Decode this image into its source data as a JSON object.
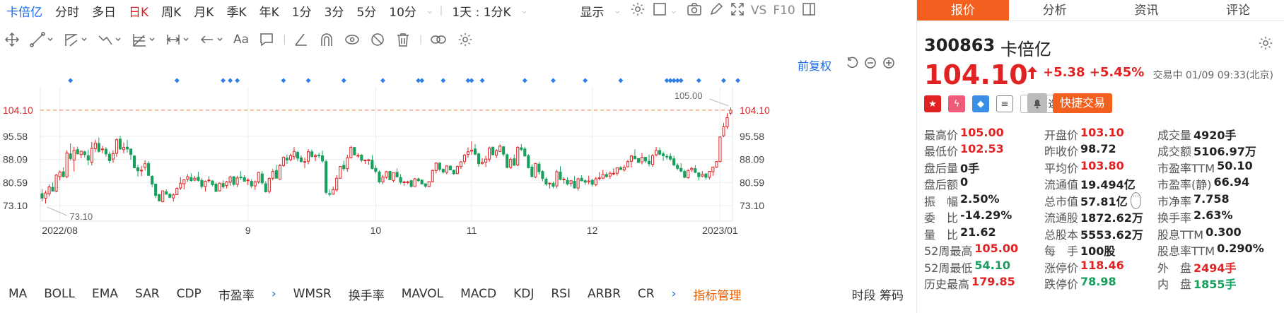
{
  "tabs": {
    "items": [
      {
        "label": "卡倍亿",
        "key": "name"
      },
      {
        "label": "分时"
      },
      {
        "label": "多日"
      },
      {
        "label": "日K",
        "active": true
      },
      {
        "label": "周K"
      },
      {
        "label": "月K"
      },
      {
        "label": "季K"
      },
      {
        "label": "年K"
      },
      {
        "label": "1分"
      },
      {
        "label": "3分"
      },
      {
        "label": "5分"
      },
      {
        "label": "10分"
      }
    ],
    "interval": "1天 : 1分K",
    "display": "显示",
    "vs": "VS",
    "f10": "F10"
  },
  "draw_tools": [
    "move-icon",
    "line-icon",
    "channel-icon",
    "wave-icon",
    "fib-icon",
    "range-icon",
    "arrow-icon",
    "text-icon",
    "comment-icon",
    "ruler-icon",
    "magnet-icon",
    "eye-icon",
    "hide-icon",
    "delete-icon",
    "link-icon",
    "settings-icon"
  ],
  "text_tool": "Aa",
  "fq": "前复权",
  "chart_data": {
    "type": "candlestick",
    "ylim": [
      73.1,
      105
    ],
    "y_ticks": [
      "104.10",
      "95.58",
      "88.09",
      "80.59",
      "73.10"
    ],
    "x_ticks": [
      "2022/08",
      "9",
      "10",
      "11",
      "12",
      "2023/01"
    ],
    "current_price": 104.1,
    "high_label": "105.00",
    "low_label": "73.10",
    "x_tick_index": [
      5,
      58,
      94,
      121,
      155,
      191
    ],
    "diamond_markers_index": [
      8,
      38,
      51,
      53,
      55,
      68,
      75,
      85,
      96,
      106,
      107,
      113,
      120,
      121,
      124,
      136,
      144,
      153,
      163,
      176,
      177,
      178,
      179,
      180,
      185,
      192,
      196
    ],
    "candles": [
      [
        77.0,
        78.5,
        74.5,
        75.5
      ],
      [
        75.5,
        78.0,
        73.8,
        77.2
      ],
      [
        76.9,
        80.0,
        76.1,
        79.2
      ],
      [
        79.0,
        80.6,
        77.7,
        77.8
      ],
      [
        77.8,
        83.4,
        77.4,
        83.0
      ],
      [
        82.5,
        84.5,
        81.3,
        84.0
      ],
      [
        84.1,
        85.5,
        82.3,
        82.5
      ],
      [
        82.5,
        91.0,
        82.0,
        90.2
      ],
      [
        89.9,
        93.3,
        87.7,
        88.4
      ],
      [
        87.9,
        92.2,
        84.2,
        91.0
      ],
      [
        91.3,
        92.3,
        89.8,
        89.9
      ],
      [
        89.7,
        90.8,
        88.5,
        90.8
      ],
      [
        90.6,
        90.9,
        88.7,
        89.7
      ],
      [
        89.3,
        91.3,
        86.3,
        87.9
      ],
      [
        87.2,
        93.8,
        86.2,
        91.7
      ],
      [
        91.6,
        94.5,
        90.5,
        93.4
      ],
      [
        93.3,
        95.2,
        90.3,
        90.7
      ],
      [
        91.3,
        92.5,
        90.1,
        91.5
      ],
      [
        91.4,
        92.1,
        89.0,
        89.9
      ],
      [
        89.8,
        90.6,
        86.8,
        87.7
      ],
      [
        88.2,
        91.1,
        87.0,
        90.0
      ],
      [
        90.1,
        95.0,
        88.9,
        94.5
      ],
      [
        94.7,
        95.8,
        91.2,
        91.5
      ],
      [
        91.3,
        93.6,
        90.0,
        92.0
      ],
      [
        92.1,
        94.5,
        90.3,
        91.5
      ],
      [
        91.5,
        91.6,
        88.0,
        89.7
      ],
      [
        89.2,
        89.6,
        85.2,
        85.4
      ],
      [
        85.4,
        86.3,
        82.5,
        84.4
      ],
      [
        84.4,
        86.0,
        82.7,
        84.6
      ],
      [
        85.5,
        87.8,
        84.5,
        86.7
      ],
      [
        86.8,
        87.5,
        82.9,
        82.9
      ],
      [
        82.6,
        83.0,
        79.1,
        80.1
      ],
      [
        80.1,
        80.2,
        75.5,
        76.4
      ],
      [
        76.7,
        76.9,
        74.5,
        74.6
      ],
      [
        74.4,
        77.9,
        74.1,
        77.9
      ],
      [
        77.6,
        78.4,
        76.8,
        76.8
      ],
      [
        76.8,
        77.2,
        75.5,
        75.8
      ],
      [
        75.6,
        77.1,
        74.4,
        76.6
      ],
      [
        76.7,
        79.0,
        76.6,
        78.7
      ],
      [
        78.8,
        82.4,
        78.2,
        80.3
      ],
      [
        80.2,
        81.7,
        78.4,
        81.5
      ],
      [
        81.7,
        83.3,
        80.9,
        82.5
      ],
      [
        82.2,
        83.6,
        80.9,
        81.2
      ],
      [
        81.4,
        82.7,
        81.0,
        82.0
      ],
      [
        82.3,
        84.1,
        80.9,
        81.3
      ],
      [
        81.3,
        82.0,
        78.6,
        79.3
      ],
      [
        79.3,
        81.3,
        77.7,
        81.0
      ],
      [
        81.2,
        82.6,
        80.6,
        81.4
      ],
      [
        81.1,
        81.4,
        79.4,
        79.9
      ],
      [
        80.1,
        80.5,
        77.6,
        77.7
      ],
      [
        77.9,
        80.6,
        77.7,
        80.4
      ],
      [
        80.3,
        81.3,
        78.6,
        79.2
      ],
      [
        79.6,
        81.1,
        78.7,
        80.8
      ],
      [
        80.7,
        82.8,
        79.6,
        82.4
      ],
      [
        82.5,
        82.6,
        79.4,
        80.0
      ],
      [
        80.0,
        82.8,
        79.1,
        82.1
      ],
      [
        82.4,
        84.3,
        81.4,
        82.2
      ],
      [
        82.2,
        83.0,
        80.9,
        81.0
      ],
      [
        81.3,
        82.0,
        79.8,
        81.4
      ],
      [
        81.0,
        81.7,
        78.8,
        79.5
      ],
      [
        79.5,
        81.3,
        78.2,
        80.8
      ],
      [
        80.8,
        84.1,
        80.2,
        83.9
      ],
      [
        83.4,
        84.3,
        79.9,
        80.5
      ],
      [
        80.2,
        81.0,
        77.3,
        77.6
      ],
      [
        77.7,
        82.3,
        77.0,
        81.9
      ],
      [
        82.0,
        85.0,
        81.3,
        84.2
      ],
      [
        84.5,
        86.3,
        82.0,
        82.0
      ],
      [
        81.7,
        86.7,
        81.5,
        86.1
      ],
      [
        86.1,
        89.1,
        85.7,
        88.8
      ],
      [
        88.5,
        89.7,
        86.6,
        87.9
      ],
      [
        88.0,
        90.0,
        87.5,
        89.3
      ],
      [
        89.0,
        92.1,
        88.0,
        90.7
      ],
      [
        90.4,
        90.9,
        87.5,
        88.5
      ],
      [
        88.6,
        89.4,
        87.1,
        87.4
      ],
      [
        87.2,
        88.7,
        85.3,
        87.4
      ],
      [
        87.5,
        91.4,
        86.5,
        90.6
      ],
      [
        90.6,
        91.3,
        88.7,
        89.1
      ],
      [
        89.0,
        89.9,
        87.5,
        89.4
      ],
      [
        89.5,
        90.3,
        88.5,
        89.4
      ],
      [
        89.3,
        91.0,
        87.0,
        87.6
      ],
      [
        87.4,
        88.0,
        76.7,
        77.4
      ],
      [
        77.0,
        78.3,
        76.1,
        76.8
      ],
      [
        76.8,
        79.3,
        76.7,
        78.3
      ],
      [
        78.2,
        83.0,
        77.6,
        82.0
      ],
      [
        82.0,
        86.0,
        81.8,
        85.8
      ],
      [
        86.2,
        87.7,
        84.4,
        85.1
      ],
      [
        85.1,
        89.6,
        84.1,
        88.6
      ],
      [
        88.6,
        92.5,
        88.4,
        92.0
      ],
      [
        92.0,
        92.1,
        89.4,
        89.6
      ],
      [
        89.3,
        90.1,
        88.6,
        89.4
      ],
      [
        89.5,
        89.8,
        87.2,
        87.8
      ],
      [
        87.7,
        88.0,
        86.6,
        87.9
      ],
      [
        87.7,
        88.3,
        86.4,
        88.0
      ],
      [
        87.8,
        89.5,
        84.9,
        85.1
      ],
      [
        85.2,
        86.2,
        83.5,
        84.2
      ],
      [
        84.0,
        84.6,
        80.3,
        80.8
      ],
      [
        80.8,
        83.1,
        80.1,
        82.4
      ],
      [
        82.3,
        84.4,
        81.8,
        84.1
      ],
      [
        84.2,
        84.4,
        81.5,
        81.5
      ],
      [
        81.3,
        83.8,
        80.7,
        83.8
      ],
      [
        83.9,
        85.2,
        82.4,
        82.4
      ],
      [
        82.2,
        83.3,
        80.1,
        80.7
      ],
      [
        80.6,
        81.2,
        79.6,
        80.8
      ],
      [
        80.8,
        81.2,
        80.1,
        80.8
      ],
      [
        81.2,
        81.5,
        79.0,
        79.3
      ],
      [
        79.3,
        82.1,
        79.2,
        81.8
      ],
      [
        81.8,
        82.2,
        80.8,
        81.2
      ],
      [
        81.4,
        81.6,
        80.0,
        80.1
      ],
      [
        80.2,
        80.3,
        78.9,
        79.4
      ],
      [
        79.3,
        81.0,
        79.1,
        80.9
      ],
      [
        80.9,
        84.9,
        80.7,
        84.5
      ],
      [
        84.5,
        87.2,
        83.5,
        86.9
      ],
      [
        86.9,
        87.2,
        84.2,
        84.9
      ],
      [
        84.9,
        85.3,
        83.5,
        84.0
      ],
      [
        83.9,
        86.2,
        83.3,
        86.0
      ],
      [
        85.9,
        86.2,
        84.6,
        84.7
      ],
      [
        84.6,
        84.7,
        83.0,
        83.5
      ],
      [
        83.5,
        86.1,
        83.3,
        85.8
      ],
      [
        85.8,
        87.6,
        85.0,
        87.3
      ],
      [
        87.4,
        89.9,
        86.5,
        89.5
      ],
      [
        89.7,
        92.0,
        88.7,
        90.6
      ],
      [
        90.8,
        94.0,
        89.6,
        91.1
      ],
      [
        91.5,
        93.1,
        89.4,
        89.8
      ],
      [
        89.9,
        90.3,
        85.7,
        86.7
      ],
      [
        86.8,
        88.5,
        86.4,
        87.2
      ],
      [
        87.2,
        89.3,
        85.6,
        88.2
      ],
      [
        88.2,
        92.3,
        87.3,
        91.8
      ],
      [
        92.1,
        92.2,
        89.5,
        89.6
      ],
      [
        89.5,
        91.4,
        88.5,
        90.9
      ],
      [
        90.7,
        93.0,
        90.6,
        92.4
      ],
      [
        92.2,
        92.4,
        89.1,
        89.8
      ],
      [
        89.6,
        90.1,
        85.2,
        85.5
      ],
      [
        85.5,
        88.7,
        85.0,
        88.1
      ],
      [
        88.3,
        89.7,
        86.0,
        86.2
      ],
      [
        86.3,
        92.4,
        85.9,
        92.0
      ],
      [
        91.9,
        93.1,
        90.8,
        91.3
      ],
      [
        91.5,
        92.2,
        89.1,
        89.2
      ],
      [
        89.3,
        89.8,
        85.2,
        85.4
      ],
      [
        85.6,
        86.5,
        82.4,
        82.5
      ],
      [
        82.4,
        86.9,
        82.0,
        86.8
      ],
      [
        86.6,
        87.2,
        83.2,
        84.1
      ],
      [
        84.2,
        84.6,
        81.0,
        81.9
      ],
      [
        81.7,
        82.3,
        79.5,
        80.1
      ],
      [
        80.2,
        80.6,
        78.6,
        80.4
      ],
      [
        80.3,
        80.9,
        78.7,
        79.4
      ],
      [
        79.5,
        84.7,
        78.7,
        84.1
      ],
      [
        84.0,
        85.9,
        81.3,
        81.6
      ],
      [
        81.6,
        82.3,
        80.2,
        81.7
      ],
      [
        81.3,
        82.3,
        79.7,
        80.1
      ],
      [
        80.3,
        81.2,
        79.3,
        81.2
      ],
      [
        81.0,
        82.7,
        78.7,
        78.8
      ],
      [
        78.8,
        82.2,
        78.0,
        81.8
      ],
      [
        82.0,
        83.0,
        80.9,
        81.2
      ],
      [
        81.2,
        81.6,
        79.8,
        80.7
      ],
      [
        80.8,
        82.8,
        80.0,
        81.1
      ],
      [
        81.3,
        81.8,
        79.3,
        80.0
      ],
      [
        79.9,
        82.4,
        79.4,
        81.8
      ],
      [
        82.0,
        84.0,
        81.3,
        82.1
      ],
      [
        82.0,
        84.7,
        81.7,
        83.2
      ],
      [
        83.2,
        84.0,
        82.2,
        82.5
      ],
      [
        82.7,
        84.2,
        81.8,
        83.6
      ],
      [
        83.6,
        85.2,
        83.0,
        83.6
      ],
      [
        83.6,
        85.4,
        82.8,
        85.4
      ],
      [
        85.4,
        85.9,
        84.7,
        84.8
      ],
      [
        84.7,
        86.3,
        84.1,
        85.5
      ],
      [
        85.7,
        87.9,
        85.7,
        87.4
      ],
      [
        87.5,
        89.6,
        85.5,
        89.2
      ],
      [
        89.1,
        91.4,
        88.3,
        88.3
      ],
      [
        88.4,
        88.5,
        87.0,
        87.1
      ],
      [
        87.3,
        90.2,
        86.5,
        88.8
      ],
      [
        88.8,
        88.8,
        86.9,
        87.6
      ],
      [
        87.5,
        89.7,
        85.8,
        86.7
      ],
      [
        86.5,
        89.9,
        85.7,
        89.4
      ],
      [
        89.6,
        92.2,
        89.0,
        91.0
      ],
      [
        91.0,
        92.0,
        89.4,
        89.8
      ],
      [
        89.9,
        90.6,
        87.6,
        89.3
      ],
      [
        89.1,
        89.9,
        88.1,
        89.0
      ],
      [
        89.1,
        90.1,
        87.6,
        88.2
      ],
      [
        88.3,
        89.3,
        85.9,
        86.3
      ],
      [
        86.2,
        86.9,
        84.6,
        85.2
      ],
      [
        85.2,
        86.9,
        83.9,
        84.3
      ],
      [
        84.2,
        84.8,
        82.0,
        82.3
      ],
      [
        82.2,
        84.9,
        81.8,
        84.5
      ],
      [
        84.7,
        85.7,
        84.0,
        85.2
      ],
      [
        85.1,
        86.2,
        83.6,
        83.9
      ],
      [
        83.7,
        84.0,
        81.3,
        82.5
      ],
      [
        82.7,
        84.3,
        82.3,
        83.2
      ],
      [
        83.4,
        83.5,
        81.5,
        82.3
      ],
      [
        82.3,
        84.3,
        81.6,
        84.2
      ],
      [
        84.1,
        85.8,
        82.8,
        85.6
      ],
      [
        85.6,
        87.6,
        85.3,
        87.4
      ],
      [
        87.4,
        95.6,
        87.2,
        95.4
      ],
      [
        95.8,
        100.0,
        95.3,
        98.7
      ],
      [
        98.7,
        103.1,
        98.0,
        101.7
      ],
      [
        103.1,
        105.0,
        102.5,
        104.1
      ]
    ]
  },
  "quote": {
    "code": "300863",
    "name": "卡倍亿",
    "price": "104.10",
    "change": "+5.38",
    "pct": "+5.45%",
    "status": "交易中 01/09 09:33(北京)",
    "zixuan": "自选",
    "fast_trade": "快捷交易",
    "rows": [
      [
        {
          "k": "最高价",
          "v": "105.00",
          "c": "red"
        },
        {
          "k": "开盘价",
          "v": "103.10",
          "c": "red"
        },
        {
          "k": "成交量",
          "v": "4920手",
          "c": "blk"
        }
      ],
      [
        {
          "k": "最低价",
          "v": "102.53",
          "c": "red"
        },
        {
          "k": "昨收价",
          "v": "98.72",
          "c": "blk"
        },
        {
          "k": "成交额",
          "v": "5106.97万",
          "c": "blk"
        }
      ],
      [
        {
          "k": "盘后量",
          "v": "0手",
          "c": "blk"
        },
        {
          "k": "平均价",
          "v": "103.80",
          "c": "red"
        },
        {
          "k": "市盈率TTM",
          "v": "50.10",
          "c": "blk"
        }
      ],
      [
        {
          "k": "盘后额",
          "v": "0",
          "c": "blk"
        },
        {
          "k": "流通值",
          "v": "19.494亿",
          "c": "blk"
        },
        {
          "k": "市盈率(静)",
          "v": "66.94",
          "c": "blk"
        }
      ],
      [
        {
          "k": "振　幅",
          "v": "2.50%",
          "c": "blk"
        },
        {
          "k": "总市值",
          "v": "57.81亿",
          "c": "blk",
          "more": "···"
        },
        {
          "k": "市净率",
          "v": "7.758",
          "c": "blk"
        }
      ],
      [
        {
          "k": "委　比",
          "v": "-14.29%",
          "c": "blk"
        },
        {
          "k": "流通股",
          "v": "1872.62万",
          "c": "blk"
        },
        {
          "k": "换手率",
          "v": "2.63%",
          "c": "blk"
        }
      ],
      [
        {
          "k": "量　比",
          "v": "21.62",
          "c": "blk"
        },
        {
          "k": "总股本",
          "v": "5553.62万",
          "c": "blk"
        },
        {
          "k": "股息TTM",
          "v": "0.300",
          "c": "blk"
        }
      ],
      [
        {
          "k": "52周最高",
          "v": "105.00",
          "c": "red"
        },
        {
          "k": "每　手",
          "v": "100股",
          "c": "blk"
        },
        {
          "k": "股息率TTM",
          "v": "0.290%",
          "c": "blk"
        }
      ],
      [
        {
          "k": "52周最低",
          "v": "54.10",
          "c": "grn"
        },
        {
          "k": "涨停价",
          "v": "118.46",
          "c": "red"
        },
        {
          "k": "外　盘",
          "v": "2494手",
          "c": "red"
        }
      ],
      [
        {
          "k": "历史最高",
          "v": "179.85",
          "c": "red"
        },
        {
          "k": "跌停价",
          "v": "78.98",
          "c": "grn"
        },
        {
          "k": "内　盘",
          "v": "1855手",
          "c": "grn"
        }
      ]
    ]
  },
  "right_tabs": [
    {
      "label": "报价",
      "active": true
    },
    {
      "label": "分析"
    },
    {
      "label": "资讯"
    },
    {
      "label": "评论"
    }
  ],
  "indicators": [
    "MA",
    "BOLL",
    "EMA",
    "SAR",
    "CDP",
    "市盈率",
    "WMSR",
    "换手率",
    "MAVOL",
    "MACD",
    "KDJ",
    "RSI",
    "ARBR",
    "CR"
  ],
  "indicator_manage": "指标管理",
  "bottom_right": "时段 筹码"
}
